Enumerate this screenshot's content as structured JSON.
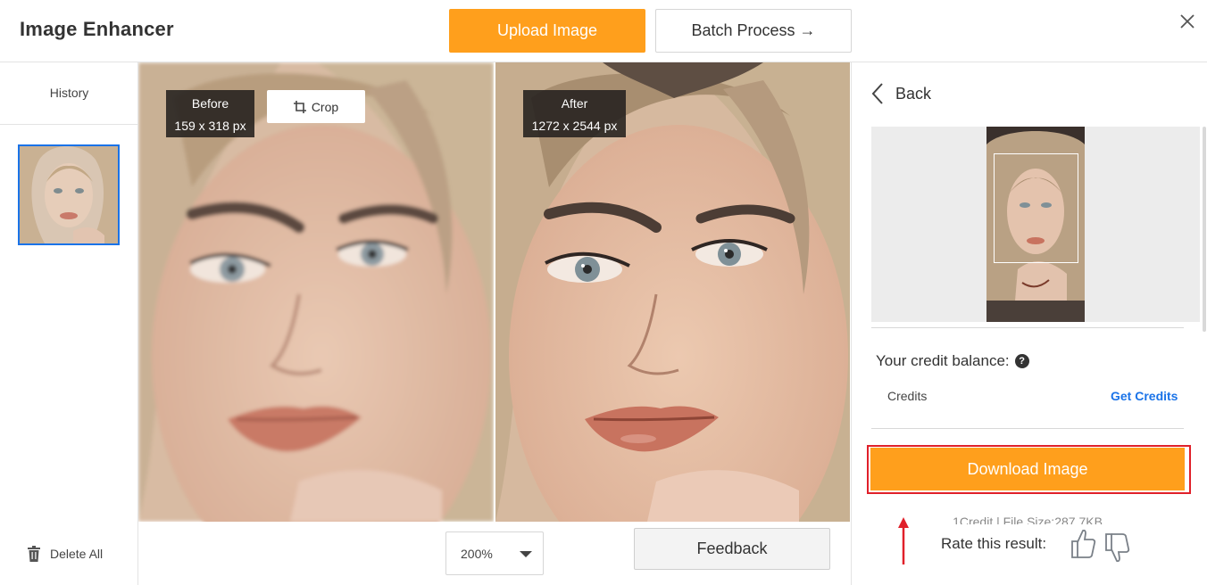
{
  "header": {
    "title": "Image Enhancer",
    "upload_label": "Upload Image",
    "batch_label": "Batch Process →"
  },
  "sidebar": {
    "history_label": "History",
    "delete_all_label": "Delete All"
  },
  "preview": {
    "before": {
      "label": "Before",
      "size": "159 x 318 px"
    },
    "after": {
      "label": "After",
      "size": "1272 x 2544 px"
    },
    "crop_label": "Crop",
    "zoom_value": "200%",
    "feedback_label": "Feedback"
  },
  "right_panel": {
    "back_label": "Back",
    "credit_balance_label": "Your credit balance:",
    "credits_label": "Credits",
    "get_credits_label": "Get Credits",
    "download_label": "Download Image",
    "file_info": "1Credit | File Size:287.7KB",
    "rate_label": "Rate this result:"
  },
  "colors": {
    "accent_orange": "#ff9f1c",
    "link_blue": "#1a73e8",
    "highlight_red": "#e0202a"
  }
}
